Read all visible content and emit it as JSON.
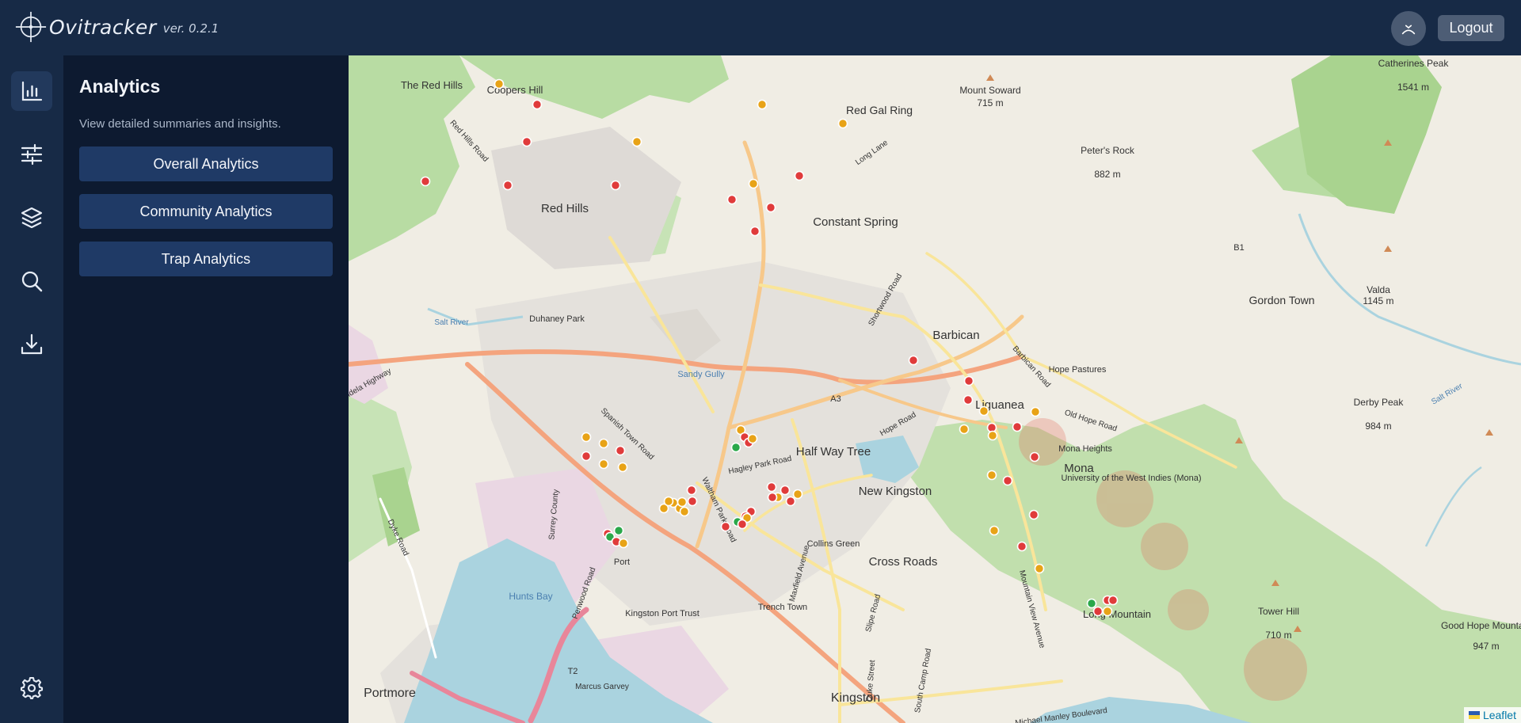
{
  "app": {
    "name": "Ovitracker",
    "version": "ver. 0.2.1"
  },
  "header": {
    "logout_label": "Logout",
    "user_icon": "user-icon"
  },
  "rail": {
    "items": [
      {
        "name": "analytics",
        "icon": "bar-chart-icon",
        "active": true
      },
      {
        "name": "filters",
        "icon": "sliders-icon",
        "active": false
      },
      {
        "name": "layers",
        "icon": "layers-icon",
        "active": false
      },
      {
        "name": "search",
        "icon": "search-icon",
        "active": false
      },
      {
        "name": "download",
        "icon": "download-icon",
        "active": false
      }
    ],
    "settings_icon": "gear-icon"
  },
  "panel": {
    "title": "Analytics",
    "subtitle": "View detailed summaries and insights.",
    "buttons": [
      {
        "label": "Overall Analytics"
      },
      {
        "label": "Community Analytics"
      },
      {
        "label": "Trap Analytics"
      }
    ]
  },
  "map": {
    "attribution": "Leaflet",
    "places": [
      "The Red Hills",
      "Coopers Hill",
      "Red Hills",
      "Red Hills Road",
      "Red Gal Ring",
      "Long Lane",
      "Mount Soward",
      "715 m",
      "Peter's Rock",
      "882 m",
      "Catherines Peak",
      "1541 m",
      "Constant Spring",
      "Shortwood Road",
      "Duhaney Park",
      "Salt River",
      "Barbican",
      "Barbican Road",
      "Hope Pastures",
      "Liguanea",
      "Old Hope Road",
      "Gordon Town",
      "Valda",
      "1145 m",
      "B1",
      "A3",
      "Half Way Tree",
      "Hagley Park Road",
      "Hope Road",
      "Mona Heights",
      "Mona",
      "University of the West Indies (Mona)",
      "Derby Peak",
      "984 m",
      "New Kingston",
      "Spanish Town Road",
      "Collins Green",
      "Cross Roads",
      "Sandy Gully",
      "Hunts Bay",
      "Port",
      "Kingston Port Trust",
      "Trench Town",
      "Long Mountain",
      "Tower Hill",
      "710 m",
      "Good Hope Mountain",
      "947 m",
      "Portmore",
      "Kingston",
      "T2",
      "Dyke Road",
      "Mandela Highway",
      "Waltham Park Road",
      "Maxfield Avenue",
      "Slipe Road",
      "Duke Street",
      "South Camp Road",
      "Mountain View Avenue",
      "Michael Manley Boulevard",
      "Marcus Garvey",
      "Surrey County",
      "Penwood Road",
      "Salt River"
    ],
    "legend_colors": {
      "red": "#e03b3b",
      "orange": "#e8a317",
      "green": "#2aa84a"
    },
    "markers": {
      "red": 40,
      "orange": 34,
      "green": 5
    }
  }
}
